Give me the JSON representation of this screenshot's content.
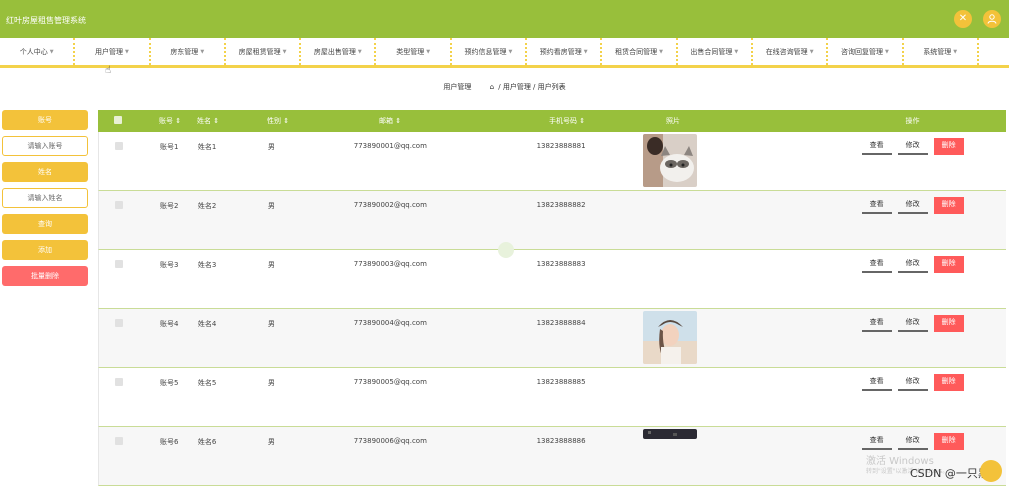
{
  "app": {
    "title": "红叶房屋租售管理系统",
    "top_buttons": [
      {
        "icon": "close-icon",
        "glyph": "✕"
      },
      {
        "icon": "user-icon",
        "glyph": "👤"
      }
    ]
  },
  "nav": {
    "items": [
      {
        "label": "个人中心"
      },
      {
        "label": "用户管理"
      },
      {
        "label": "房东管理"
      },
      {
        "label": "房屋租赁管理"
      },
      {
        "label": "房屋出售管理"
      },
      {
        "label": "类型管理"
      },
      {
        "label": "预约信息管理"
      },
      {
        "label": "预约看房管理"
      },
      {
        "label": "租赁合同管理"
      },
      {
        "label": "出售合同管理"
      },
      {
        "label": "在线咨询管理"
      },
      {
        "label": "咨询回复管理"
      },
      {
        "label": "系统管理"
      }
    ]
  },
  "breadcrumb": {
    "current": "用户管理",
    "path": "/ 用户管理 / 用户列表"
  },
  "sidebar": {
    "account_label": "账号",
    "account_placeholder": "请输入账号",
    "name_label": "姓名",
    "name_placeholder": "请输入姓名",
    "query": "查询",
    "add": "添加",
    "batch_delete": "批量删除"
  },
  "table": {
    "headers": {
      "account": "账号 ⇕",
      "name": "姓名 ⇕",
      "sex": "性别 ⇕",
      "email": "邮箱 ⇕",
      "phone": "手机号码 ⇕",
      "photo": "照片",
      "ops": "操作"
    },
    "ops": {
      "view": "查看",
      "edit": "修改",
      "delete": "删除"
    },
    "rows": [
      {
        "account": "账号1",
        "name": "姓名1",
        "sex": "男",
        "email": "773890001@qq.com",
        "phone": "13823888881",
        "photo": "cat"
      },
      {
        "account": "账号2",
        "name": "姓名2",
        "sex": "男",
        "email": "773890002@qq.com",
        "phone": "13823888882",
        "photo": "none"
      },
      {
        "account": "账号3",
        "name": "姓名3",
        "sex": "男",
        "email": "773890003@qq.com",
        "phone": "13823888883",
        "photo": "none"
      },
      {
        "account": "账号4",
        "name": "姓名4",
        "sex": "男",
        "email": "773890004@qq.com",
        "phone": "13823888884",
        "photo": "girl"
      },
      {
        "account": "账号5",
        "name": "姓名5",
        "sex": "男",
        "email": "773890005@qq.com",
        "phone": "13823888885",
        "photo": "none"
      },
      {
        "account": "账号6",
        "name": "姓名6",
        "sex": "男",
        "email": "773890006@qq.com",
        "phone": "13823888886",
        "photo": "dark"
      }
    ]
  },
  "overlay": {
    "watermark": "激活 Windows",
    "watermark_sub": "转到\"设置\"以激活 Windows。",
    "csdn": "CSDN @一只黑白"
  },
  "colors": {
    "primary": "#98bf3b",
    "accent": "#f3c23a",
    "danger": "#ff5a5a"
  }
}
